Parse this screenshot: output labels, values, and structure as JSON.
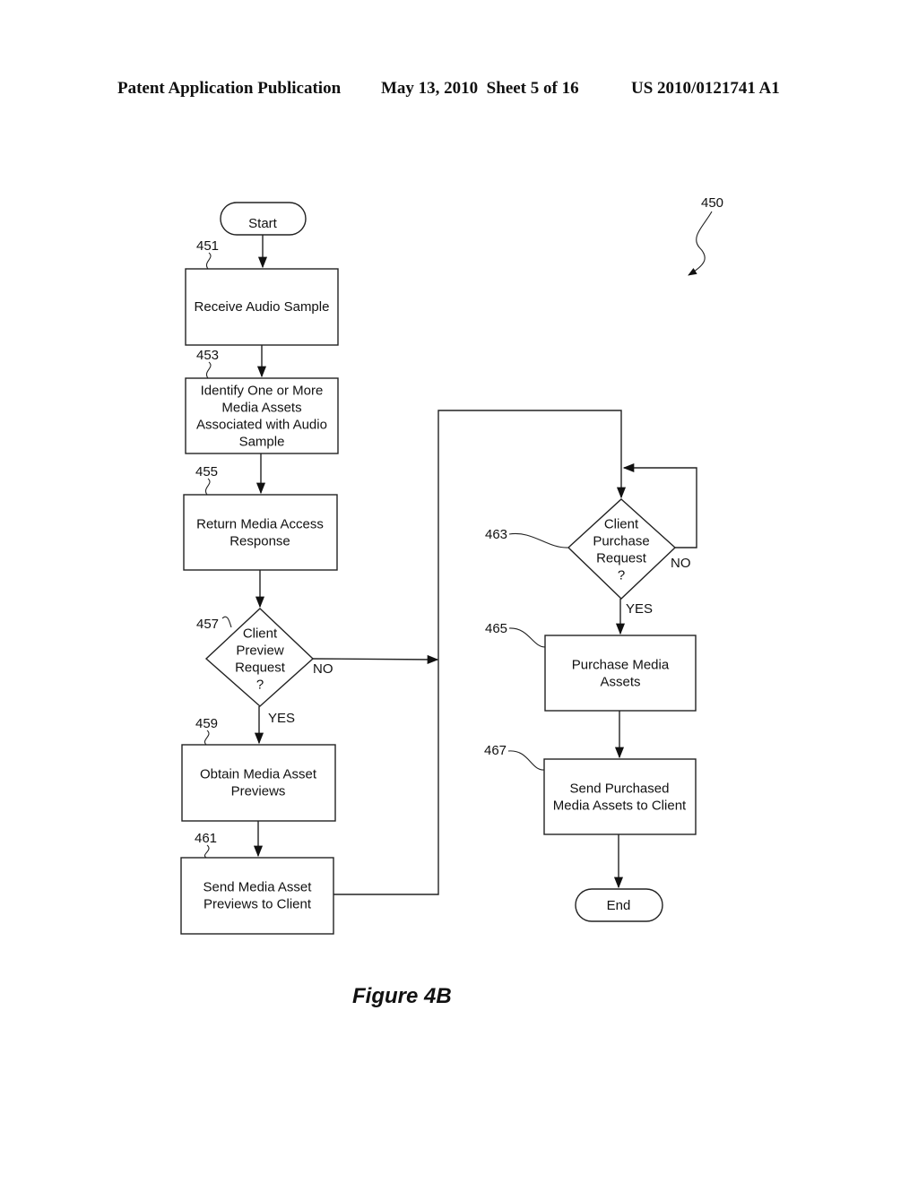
{
  "header": {
    "publication": "Patent Application Publication",
    "date_sheet": "May 13, 2010  Sheet 5 of 16",
    "number": "US 2010/0121741 A1"
  },
  "figure_ref": "450",
  "figure_caption": "Figure 4B",
  "nodes": {
    "start": {
      "type": "terminal",
      "text": [
        "Start"
      ]
    },
    "n451": {
      "ref": "451",
      "type": "process",
      "text": [
        "Receive Audio Sample"
      ]
    },
    "n453": {
      "ref": "453",
      "type": "process",
      "text": [
        "Identify One or More",
        "Media Assets",
        "Associated with Audio",
        "Sample"
      ]
    },
    "n455": {
      "ref": "455",
      "type": "process",
      "text": [
        "Return Media Access",
        "Response"
      ]
    },
    "n457": {
      "ref": "457",
      "type": "decision",
      "text": [
        "Client",
        "Preview",
        "Request",
        "?"
      ]
    },
    "n459": {
      "ref": "459",
      "type": "process",
      "text": [
        "Obtain Media Asset",
        "Previews"
      ]
    },
    "n461": {
      "ref": "461",
      "type": "process",
      "text": [
        "Send Media Asset",
        "Previews to Client"
      ]
    },
    "n463": {
      "ref": "463",
      "type": "decision",
      "text": [
        "Client",
        "Purchase",
        "Request",
        "?"
      ]
    },
    "n465": {
      "ref": "465",
      "type": "process",
      "text": [
        "Purchase Media",
        "Assets"
      ]
    },
    "n467": {
      "ref": "467",
      "type": "process",
      "text": [
        "Send Purchased",
        "Media Assets to Client"
      ]
    },
    "end": {
      "type": "terminal",
      "text": [
        "End"
      ]
    }
  },
  "edges": [
    {
      "from": "start",
      "to": "n451",
      "label": ""
    },
    {
      "from": "n451",
      "to": "n453",
      "label": ""
    },
    {
      "from": "n453",
      "to": "n455",
      "label": ""
    },
    {
      "from": "n455",
      "to": "n457",
      "label": ""
    },
    {
      "from": "n457",
      "to": "n459",
      "label": "YES"
    },
    {
      "from": "n457",
      "to": "n463",
      "label": "NO"
    },
    {
      "from": "n459",
      "to": "n461",
      "label": ""
    },
    {
      "from": "n461",
      "to": "n463",
      "label": ""
    },
    {
      "from": "n463",
      "to": "n463",
      "label": "NO"
    },
    {
      "from": "n463",
      "to": "n465",
      "label": "YES"
    },
    {
      "from": "n465",
      "to": "n467",
      "label": ""
    },
    {
      "from": "n467",
      "to": "end",
      "label": ""
    }
  ],
  "labels": {
    "yes": "YES",
    "no": "NO"
  }
}
